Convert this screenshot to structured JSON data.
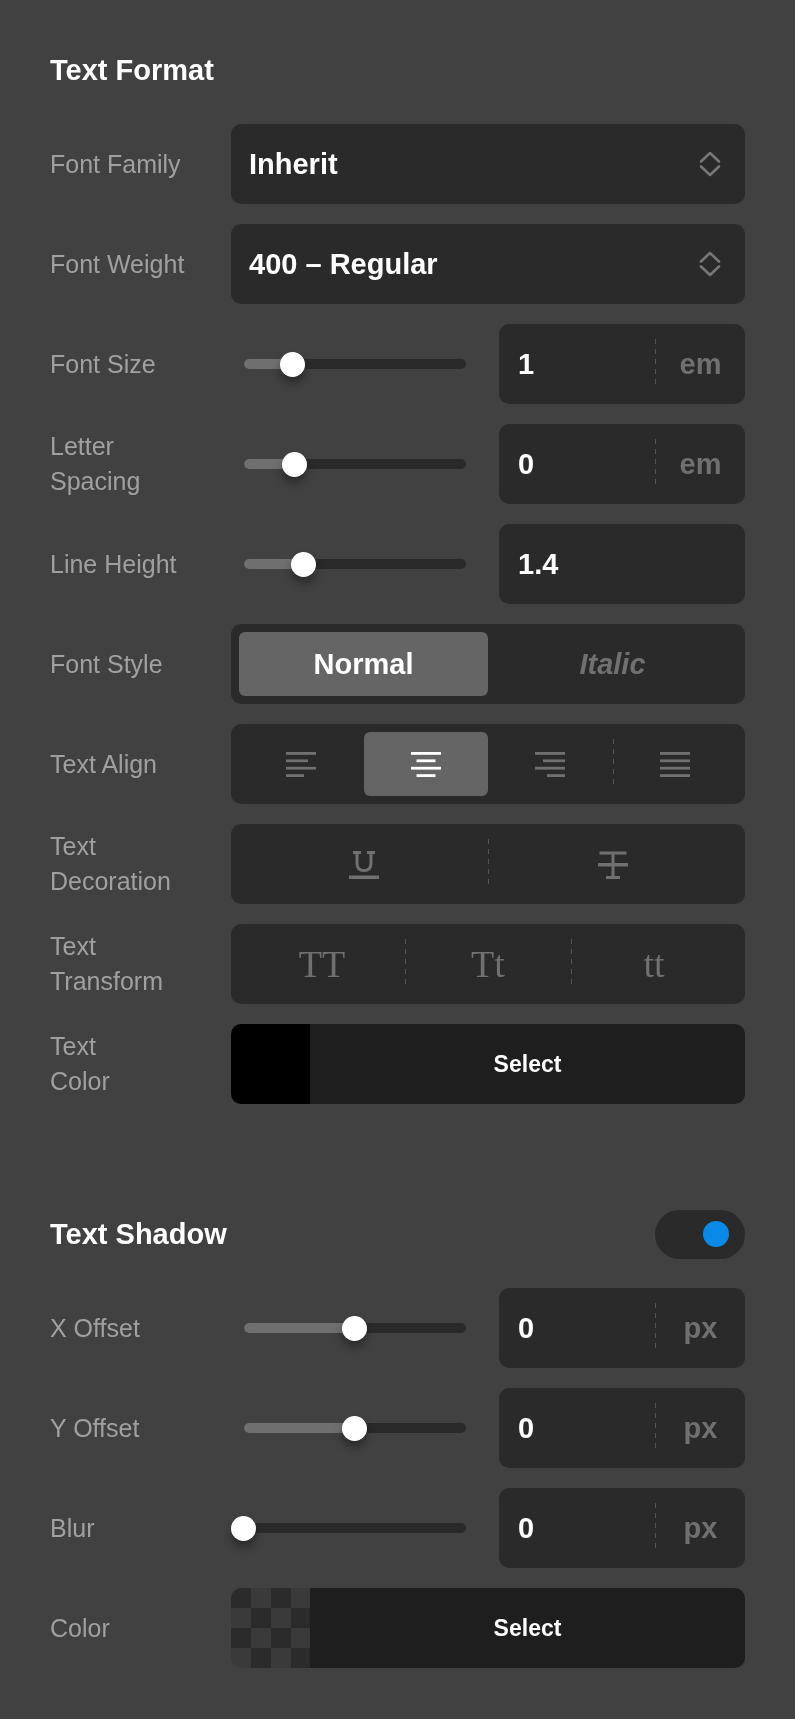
{
  "sections": [
    {
      "title": "Text Format",
      "rows": [
        {
          "kind": "select",
          "label": "Font Family",
          "value": "Inherit"
        },
        {
          "kind": "select",
          "label": "Font Weight",
          "value": "400 – Regular"
        },
        {
          "kind": "slider",
          "label": "Font Size",
          "level": 0.22,
          "value": "1",
          "unit": "em"
        },
        {
          "kind": "slider",
          "label": "Letter\nSpacing",
          "level": 0.23,
          "value": "0",
          "unit": "em"
        },
        {
          "kind": "slider",
          "label": "Line Height",
          "level": 0.27,
          "value": "1.4"
        },
        {
          "kind": "segmented",
          "label": "Font Style",
          "options": [
            {
              "kind": "label",
              "label": "Normal",
              "selected": true
            },
            {
              "kind": "italic-label",
              "label": "Italic",
              "selected": false
            }
          ]
        },
        {
          "kind": "segmented",
          "label": "Text Align",
          "options": [
            {
              "kind": "align-left",
              "selected": false
            },
            {
              "kind": "align-center",
              "selected": true
            },
            {
              "kind": "align-right",
              "selected": false
            },
            {
              "kind": "align-justify",
              "selected": false
            }
          ]
        },
        {
          "kind": "segmented",
          "label": "Text\nDecoration",
          "options": [
            {
              "kind": "underline",
              "selected": false
            },
            {
              "kind": "strikethrough",
              "selected": false
            }
          ]
        },
        {
          "kind": "segmented",
          "label": "Text\nTransform",
          "options": [
            {
              "kind": "glyph",
              "label": "TT",
              "selected": false
            },
            {
              "kind": "glyph",
              "label": "Tt",
              "selected": false
            },
            {
              "kind": "glyph",
              "label": "tt",
              "selected": false
            }
          ]
        },
        {
          "kind": "color",
          "label": "Text\nColor",
          "transparent": false,
          "color": "#000000",
          "button": "Select"
        }
      ]
    },
    {
      "title": "Text Shadow",
      "toggle": {
        "on": true
      },
      "rows": [
        {
          "kind": "slider",
          "label": "X Offset",
          "level": 0.5,
          "value": "0",
          "unit": "px"
        },
        {
          "kind": "slider",
          "label": "Y Offset",
          "level": 0.5,
          "value": "0",
          "unit": "px"
        },
        {
          "kind": "slider",
          "label": "Blur",
          "level": 0,
          "value": "0",
          "unit": "px"
        },
        {
          "kind": "color",
          "label": "Color",
          "transparent": true,
          "button": "Select"
        }
      ]
    }
  ]
}
